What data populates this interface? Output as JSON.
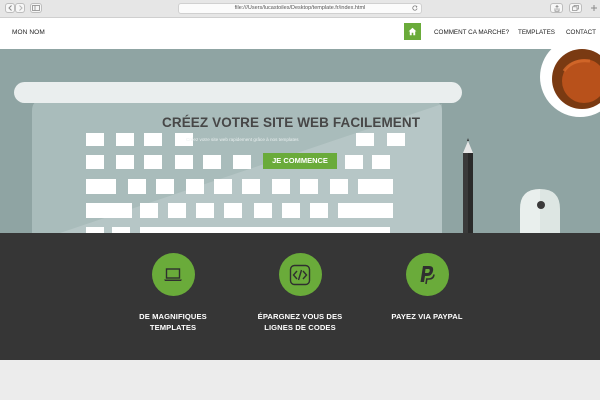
{
  "browser": {
    "url": "file:///Users/lucastoiles/Desktop/template.fr/index.html",
    "icons": [
      "back-icon",
      "forward-icon",
      "sidebar-icon",
      "reload-icon",
      "share-icon",
      "tabs-icon",
      "new-tab-icon"
    ]
  },
  "nav": {
    "brand": "MON NOM",
    "home_icon": "home-icon",
    "links": [
      "COMMENT CA MARCHE?",
      "TEMPLATES",
      "CONTACT"
    ],
    "accent": "#6aab3a"
  },
  "hero": {
    "title": "CRÉEZ VOTRE SITE WEB FACILEMENT",
    "subtitle": "Créez votre site web rapidement grâce à nos templates",
    "cta": "JE COMMENCE",
    "background": "#8fa4a3"
  },
  "features": [
    {
      "icon": "laptop-icon",
      "label_line1": "DE MAGNIFIQUES",
      "label_line2": "TEMPLATES"
    },
    {
      "icon": "code-icon",
      "label_line1": "ÉPARGNEZ VOUS DES",
      "label_line2": "LIGNES DE CODES"
    },
    {
      "icon": "paypal-icon",
      "label_line1": "PAYEZ VIA PAYPAL",
      "label_line2": ""
    }
  ],
  "colors": {
    "band": "#363636",
    "accent": "#6aab3a"
  }
}
